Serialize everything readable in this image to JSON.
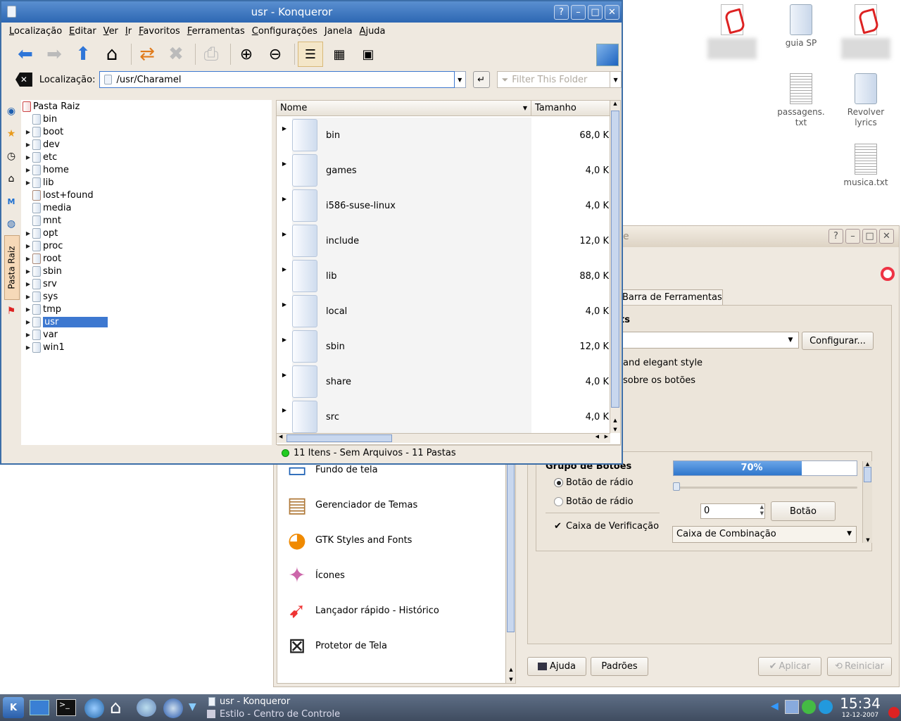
{
  "desktop": {
    "icons": [
      {
        "label": "",
        "type": "pdf",
        "blurred": true
      },
      {
        "label": "guia SP",
        "type": "folder",
        "blurred": false
      },
      {
        "label": "",
        "type": "pdf",
        "blurred": true
      },
      {
        "label": "passagens.\ntxt",
        "type": "txt",
        "blurred": false
      },
      {
        "label": "Revolver\nlyrics",
        "type": "folder",
        "blurred": false
      },
      {
        "label": "musica.txt",
        "type": "txt",
        "blurred": false
      }
    ]
  },
  "konqueror": {
    "title": "usr - Konqueror",
    "title_buttons": [
      "?",
      "–",
      "□",
      "✕"
    ],
    "menu": [
      "Localização",
      "Editar",
      "Ver",
      "Ir",
      "Favoritos",
      "Ferramentas",
      "Configurações",
      "Janela",
      "Ajuda"
    ],
    "location_label": "Localização:",
    "location_value": "/usr/Charamel",
    "filter_placeholder": "Filter This Folder",
    "sidebar_tab_label": "Pasta Raiz",
    "tree_root": "Pasta Raiz",
    "tree": [
      {
        "name": "bin",
        "expandable": false,
        "locked": false,
        "selected": false
      },
      {
        "name": "boot",
        "expandable": true,
        "locked": false,
        "selected": false
      },
      {
        "name": "dev",
        "expandable": true,
        "locked": false,
        "selected": false
      },
      {
        "name": "etc",
        "expandable": true,
        "locked": false,
        "selected": false
      },
      {
        "name": "home",
        "expandable": true,
        "locked": false,
        "selected": false
      },
      {
        "name": "lib",
        "expandable": true,
        "locked": false,
        "selected": false
      },
      {
        "name": "lost+found",
        "expandable": false,
        "locked": true,
        "selected": false
      },
      {
        "name": "media",
        "expandable": false,
        "locked": false,
        "selected": false
      },
      {
        "name": "mnt",
        "expandable": false,
        "locked": false,
        "selected": false
      },
      {
        "name": "opt",
        "expandable": true,
        "locked": false,
        "selected": false
      },
      {
        "name": "proc",
        "expandable": true,
        "locked": false,
        "selected": false
      },
      {
        "name": "root",
        "expandable": true,
        "locked": true,
        "selected": false
      },
      {
        "name": "sbin",
        "expandable": true,
        "locked": false,
        "selected": false
      },
      {
        "name": "srv",
        "expandable": true,
        "locked": false,
        "selected": false
      },
      {
        "name": "sys",
        "expandable": true,
        "locked": false,
        "selected": false
      },
      {
        "name": "tmp",
        "expandable": true,
        "locked": false,
        "selected": false
      },
      {
        "name": "usr",
        "expandable": true,
        "locked": false,
        "selected": true
      },
      {
        "name": "var",
        "expandable": true,
        "locked": false,
        "selected": false
      },
      {
        "name": "win1",
        "expandable": true,
        "locked": false,
        "selected": false
      }
    ],
    "columns": {
      "name": "Nome",
      "size": "Tamanho"
    },
    "files": [
      {
        "name": "bin",
        "size": "68,0 K"
      },
      {
        "name": "games",
        "size": "4,0 K"
      },
      {
        "name": "i586-suse-linux",
        "size": "4,0 K"
      },
      {
        "name": "include",
        "size": "12,0 K"
      },
      {
        "name": "lib",
        "size": "88,0 K"
      },
      {
        "name": "local",
        "size": "4,0 K"
      },
      {
        "name": "sbin",
        "size": "12,0 K"
      },
      {
        "name": "share",
        "size": "4,0 K"
      },
      {
        "name": "src",
        "size": "4,0 K"
      }
    ],
    "status": "11 Itens - Sem Arquivos - 11 Pastas"
  },
  "control_center": {
    "title_partial": "e",
    "tab_label": "Barra de Ferramentas",
    "group_partial": "ts",
    "configure_button": "Configurar...",
    "option_text_1": "and elegant style",
    "option_text_2": "sobre os botões",
    "preview": {
      "group_title": "Grupo de Botões",
      "progress_label": "70%",
      "progress_value": 0.7,
      "radio1": "Botão de rádio",
      "radio2": "Botão de rádio",
      "spin_value": "0",
      "button": "Botão",
      "checkbox": "Caixa de Verificação",
      "combo": "Caixa de Combinação"
    },
    "modules": [
      {
        "label": "Fundo de tela",
        "icon": "wallpaper-icon"
      },
      {
        "label": "Gerenciador de Temas",
        "icon": "theme-box-icon"
      },
      {
        "label": "GTK Styles and Fonts",
        "icon": "gtk-icon"
      },
      {
        "label": "Ícones",
        "icon": "icons-icon"
      },
      {
        "label": "Lançador rápido - Histórico",
        "icon": "rocket-icon"
      },
      {
        "label": "Protetor de Tela",
        "icon": "screensaver-icon"
      }
    ],
    "buttons": {
      "help": "Ajuda",
      "defaults": "Padrões",
      "apply": "Aplicar",
      "reset": "Reiniciar"
    }
  },
  "taskbar": {
    "tasks": [
      "usr - Konqueror",
      "Estilo - Centro de Controle"
    ],
    "clock": "15:34",
    "date": "12-12-2007"
  }
}
